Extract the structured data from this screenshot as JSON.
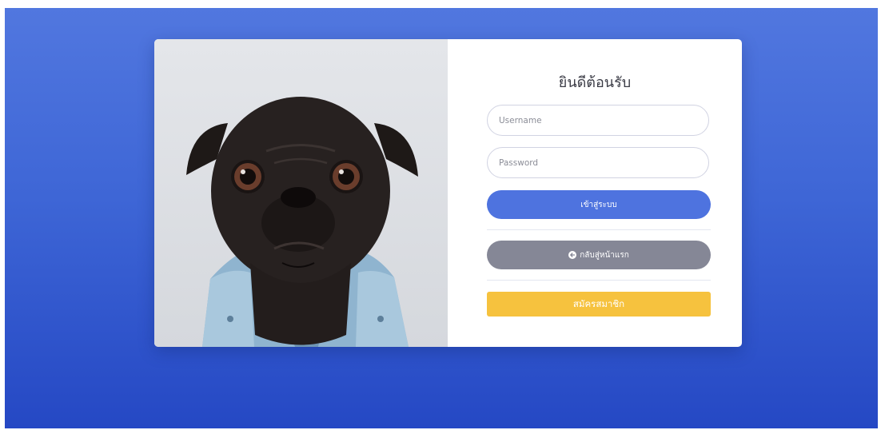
{
  "login": {
    "title": "ยินดีต้อนรับ",
    "username_placeholder": "Username",
    "password_placeholder": "Password",
    "login_button": "เข้าสู่ระบบ",
    "home_button": "กลับสู่หน้าแรก",
    "home_icon": "arrow-circle-left-icon",
    "register_button": "สมัครสมาชิก"
  },
  "image": {
    "subject": "pug-dog-photo"
  },
  "colors": {
    "background_top": "#5177df",
    "background_bottom": "#2548c4",
    "primary": "#4e73df",
    "secondary": "#858796",
    "warning": "#f6c23e"
  }
}
